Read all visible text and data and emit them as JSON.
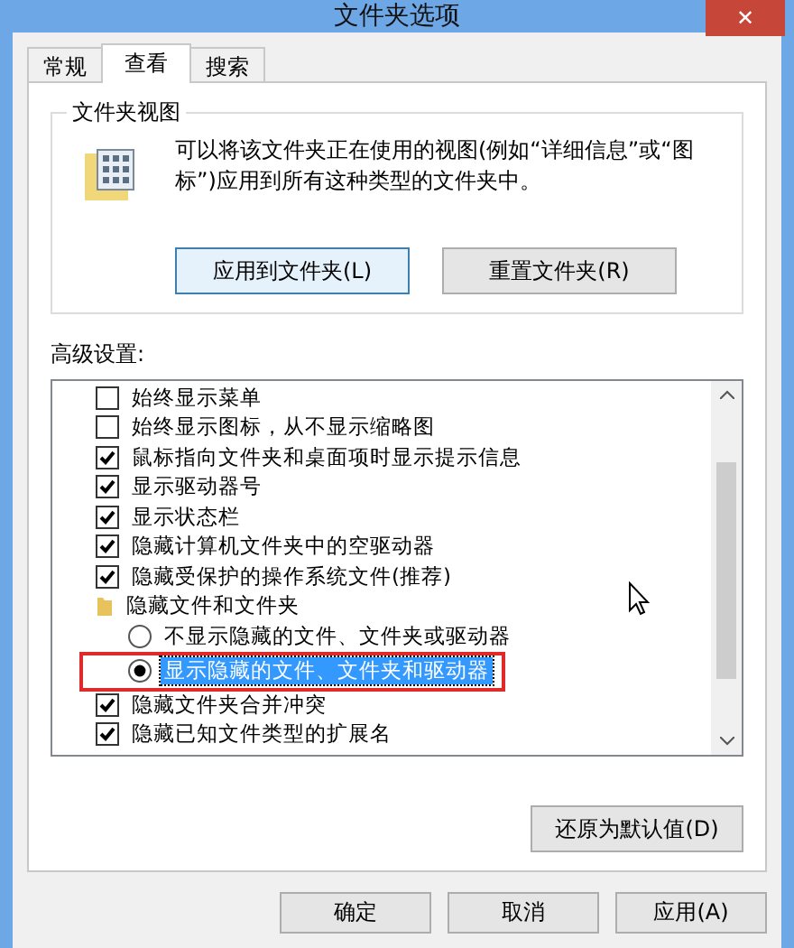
{
  "window": {
    "title": "文件夹选项",
    "close": "✕"
  },
  "tabs": [
    {
      "label": "常规",
      "selected": false
    },
    {
      "label": "查看",
      "selected": true
    },
    {
      "label": "搜索",
      "selected": false
    }
  ],
  "folder_view": {
    "title": "文件夹视图",
    "description": "可以将该文件夹正在使用的视图(例如“详细信息”或“图标”)应用到所有这种类型的文件夹中。",
    "buttons": [
      "应用到文件夹(L)",
      "重置文件夹(R)"
    ]
  },
  "advanced": {
    "label": "高级设置:",
    "items": [
      {
        "kind": "checkbox",
        "label": "始终显示菜单",
        "checked": false
      },
      {
        "kind": "checkbox",
        "label": "始终显示图标，从不显示缩略图",
        "checked": false
      },
      {
        "kind": "checkbox",
        "label": "鼠标指向文件夹和桌面项时显示提示信息",
        "checked": true
      },
      {
        "kind": "checkbox",
        "label": "显示驱动器号",
        "checked": true
      },
      {
        "kind": "checkbox",
        "label": "显示状态栏",
        "checked": true
      },
      {
        "kind": "checkbox",
        "label": "隐藏计算机文件夹中的空驱动器",
        "checked": true
      },
      {
        "kind": "checkbox",
        "label": "隐藏受保护的操作系统文件(推荐)",
        "checked": true
      },
      {
        "kind": "folder",
        "label": "隐藏文件和文件夹",
        "children": [
          {
            "kind": "radio",
            "label": "不显示隐藏的文件、文件夹或驱动器",
            "selected": false,
            "marked": false
          },
          {
            "kind": "radio",
            "label": "显示隐藏的文件、文件夹和驱动器",
            "selected": true,
            "marked": true
          }
        ]
      },
      {
        "kind": "checkbox",
        "label": "隐藏文件夹合并冲突",
        "checked": true
      },
      {
        "kind": "checkbox",
        "label": "隐藏已知文件类型的扩展名",
        "checked": true
      }
    ],
    "restore_button": "还原为默认值(D)"
  },
  "buttons": [
    "确定",
    "取消",
    "应用(A)"
  ]
}
